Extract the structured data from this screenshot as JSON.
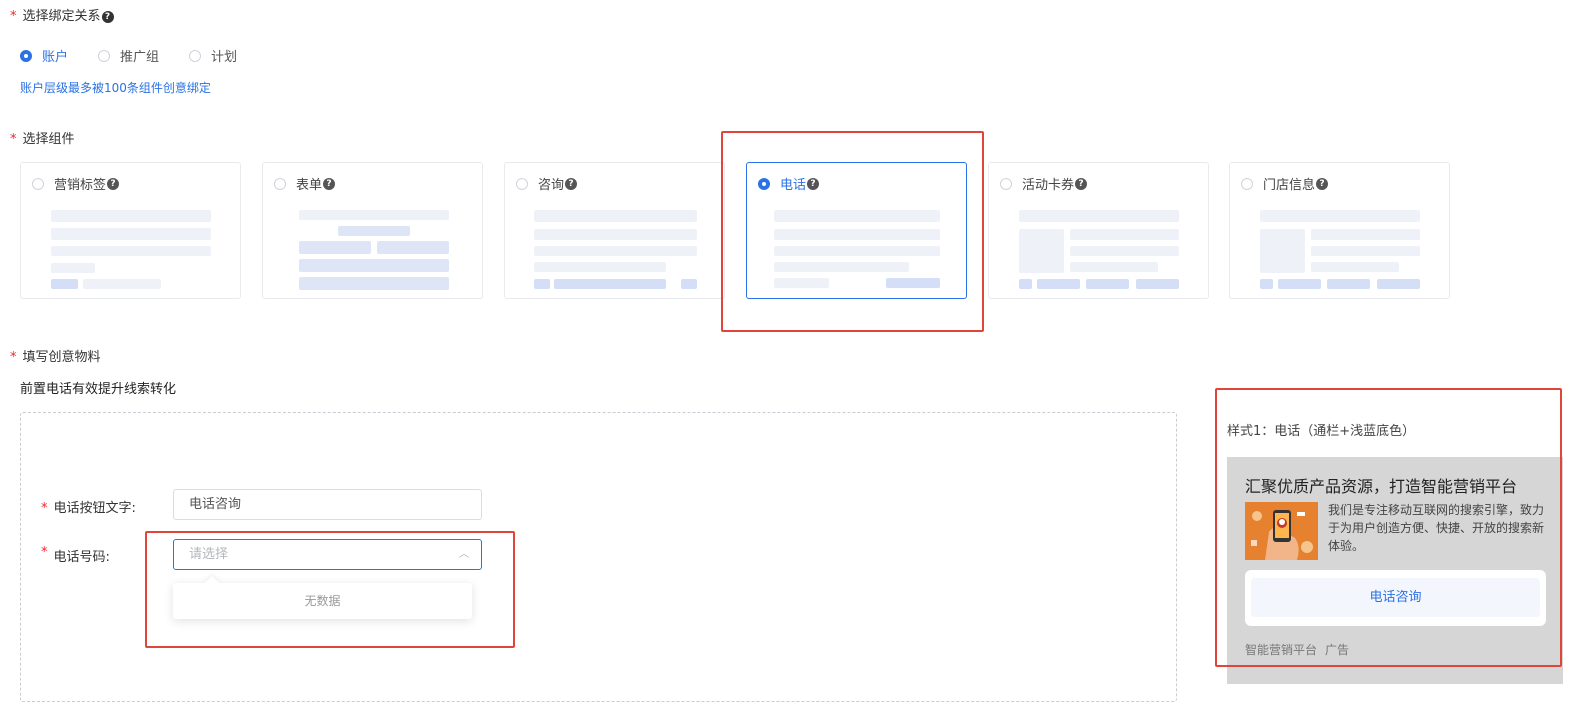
{
  "binding": {
    "label": "选择绑定关系",
    "options": [
      "账户",
      "推广组",
      "计划"
    ],
    "selected": "账户",
    "hint": "账户层级最多被100条组件创意绑定"
  },
  "components": {
    "label": "选择组件",
    "cards": [
      "营销标签",
      "表单",
      "咨询",
      "电话",
      "活动卡券",
      "门店信息"
    ],
    "selected": "电话"
  },
  "creative": {
    "label": "填写创意物料",
    "subtitle": "前置电话有效提升线索转化",
    "button_text_label": "电话按钮文字:",
    "button_text_value": "电话咨询",
    "phone_label": "电话号码:",
    "phone_placeholder": "请选择",
    "dropdown_empty": "无数据"
  },
  "preview": {
    "style_label": "样式1：电话（通栏+浅蓝底色）",
    "headline": "汇聚优质产品资源，打造智能营销平台",
    "description": "我们是专注移动互联网的搜索引擎，致力于为用户创造方便、快捷、开放的搜索新体验。",
    "button": "电话咨询",
    "brand": "智能营销平台",
    "ad_tag": "广告"
  },
  "colors": {
    "accent": "#2a72e5",
    "required_star": "#f5222d",
    "highlight_box": "#e0453a"
  }
}
